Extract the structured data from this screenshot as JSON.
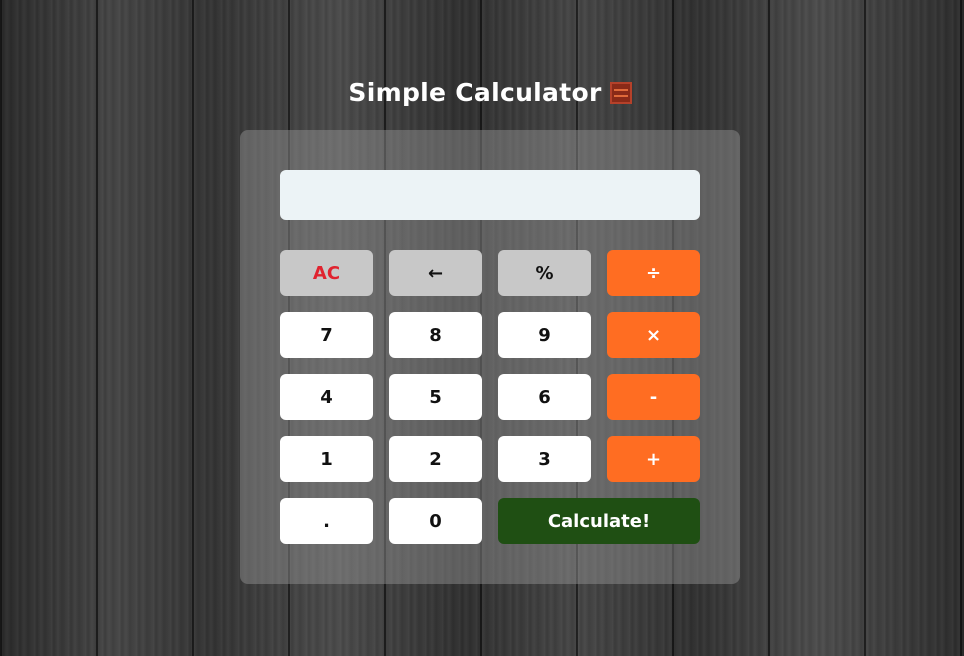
{
  "title": {
    "text": "Simple Calculator",
    "icon": "abacus-icon"
  },
  "display": {
    "value": "",
    "placeholder": ""
  },
  "buttons": {
    "ac": "AC",
    "backspace": "←",
    "percent": "%",
    "divide": "÷",
    "seven": "7",
    "eight": "8",
    "nine": "9",
    "multiply": "×",
    "four": "4",
    "five": "5",
    "six": "6",
    "subtract": "-",
    "one": "1",
    "two": "2",
    "three": "3",
    "add": "+",
    "decimal": ".",
    "zero": "0",
    "calculate": "Calculate!"
  },
  "colors": {
    "operator": "#ff6d22",
    "function": "#c8c8c8",
    "calculate": "#1f4f13",
    "clear_text": "#e0232f",
    "display_bg": "#ecf3f6"
  }
}
